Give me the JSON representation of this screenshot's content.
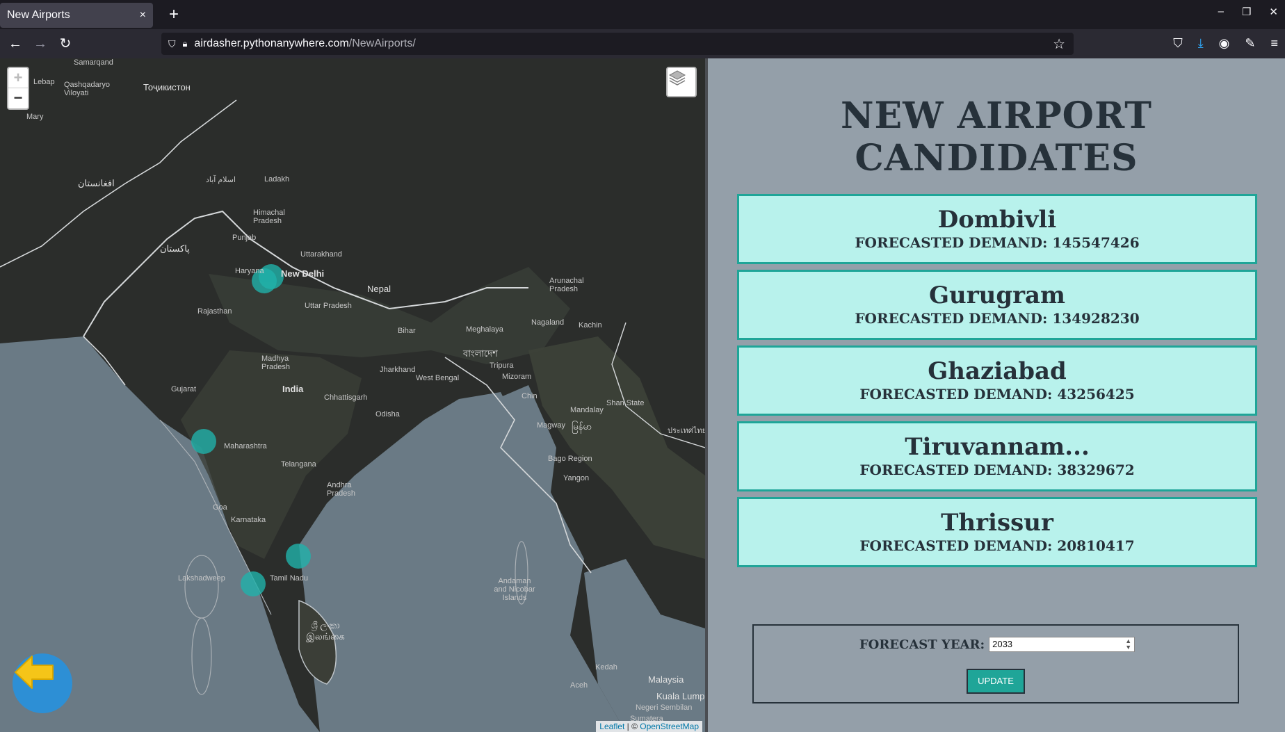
{
  "browser": {
    "tab_title": "New Airports",
    "tab_close": "×",
    "new_tab": "+",
    "url_host": "airdasher.pythonanywhere.com",
    "url_path": "/NewAirports/",
    "window_controls": [
      "–",
      "❐",
      "✕"
    ]
  },
  "map": {
    "zoom_in": "+",
    "zoom_out": "−",
    "attribution_leaflet": "Leaflet",
    "attribution_sep": " | © ",
    "attribution_osm": "OpenStreetMap",
    "marker_color": "#20b2aa",
    "labels": {
      "samarqand": "Samarqand",
      "lebap": "Lebap",
      "qashqadaryo": "Qashqadaryo Viloyati",
      "tajik": "Тоҷикистон",
      "mary": "Mary",
      "afghan": "افغانستان",
      "islamabad": "اسلام آباد",
      "ladakh": "Ladakh",
      "himachal": "Himachal Pradesh",
      "punjab": "Punjab",
      "pakistan": "پاکستان",
      "uttarakhand": "Uttarakhand",
      "haryana": "Haryana",
      "delhi": "New Delhi",
      "nepal": "Nepal",
      "rajasthan": "Rajasthan",
      "uttar": "Uttar Pradesh",
      "arunachal": "Arunachal Pradesh",
      "bihar": "Bihar",
      "meghalaya": "Meghalaya",
      "nagaland": "Nagaland",
      "kachin": "Kachin",
      "bangla": "বাংলাদেশ",
      "madhya": "Madhya Pradesh",
      "tripura": "Tripura",
      "mizoram": "Mizoram",
      "jharkhand": "Jharkhand",
      "westbengal": "West Bengal",
      "india": "India",
      "gujarat": "Gujarat",
      "chhattisgarh": "Chhattisgarh",
      "chin": "Chin",
      "mandalay": "Mandalay",
      "shan": "Shan State",
      "odisha": "Odisha",
      "magway": "Magway",
      "myanmar": "မြန်မာ",
      "thai": "ประเทศไทย",
      "maharashtra": "Maharashtra",
      "telangana": "Telangana",
      "andhra": "Andhra Pradesh",
      "bago": "Bago Region",
      "yangon": "Yangon",
      "karnataka": "Karnataka",
      "goa": "Goa",
      "lakshadweep": "Lakshadweep",
      "tamil": "Tamil Nadu",
      "andaman": "Andaman and Nicobar Islands",
      "srilanka": "ශ්‍රී ලංකා இலங்கை",
      "malaysia": "Malaysia",
      "kualalumpur": "Kuala Lump",
      "negeri": "Negeri Sembilan",
      "sumatera": "Sumatera",
      "aceh": "Aceh",
      "kedah": "Kedah"
    }
  },
  "panel": {
    "title": "NEW AIRPORT CANDIDATES",
    "demand_prefix": "FORECASTED DEMAND: ",
    "cards": [
      {
        "city": "Dombivli",
        "demand": "FORECASTED DEMAND: 145547426"
      },
      {
        "city": "Gurugram",
        "demand": "FORECASTED DEMAND: 134928230"
      },
      {
        "city": "Ghaziabad",
        "demand": "FORECASTED DEMAND: 43256425"
      },
      {
        "city": "Tiruvannam...",
        "demand": "FORECASTED DEMAND: 38329672"
      },
      {
        "city": "Thrissur",
        "demand": "FORECASTED DEMAND: 20810417"
      }
    ],
    "form": {
      "label": "FORECAST YEAR:",
      "year_value": "2033",
      "update_label": "UPDATE"
    }
  },
  "colors": {
    "panel_bg": "#949fa9",
    "card_bg": "#b8f2ec",
    "card_border": "#1fa598",
    "title_color": "#26313a",
    "fab_color": "#2d8fd5",
    "arrow_color": "#f5c518"
  }
}
